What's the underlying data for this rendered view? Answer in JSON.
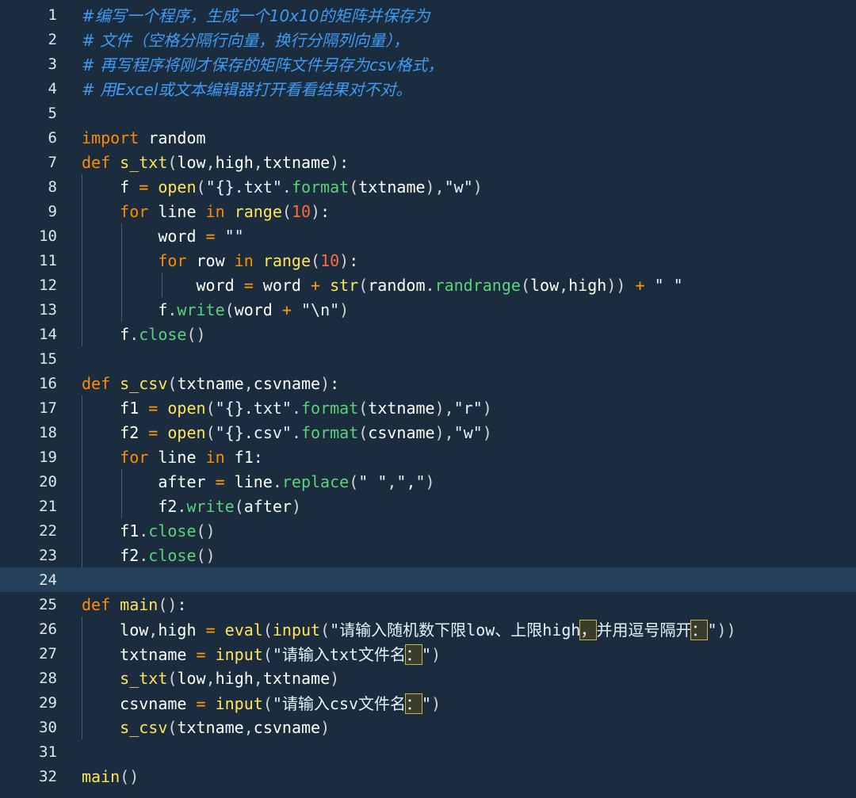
{
  "editor": {
    "current_line": 24,
    "lines": [
      {
        "n": "1",
        "code": "#编写一个程序，生成一个10x10的矩阵并保存为"
      },
      {
        "n": "2",
        "code": "# 文件（空格分隔行向量，换行分隔列向量），"
      },
      {
        "n": "3",
        "code": "# 再写程序将刚才保存的矩阵文件另存为csv格式，"
      },
      {
        "n": "4",
        "code": "# 用Excel或文本编辑器打开看看结果对不对。"
      },
      {
        "n": "5",
        "code": ""
      },
      {
        "n": "6",
        "code": "import random"
      },
      {
        "n": "7",
        "code": "def s_txt(low,high,txtname):"
      },
      {
        "n": "8",
        "code": "    f = open(\"{}.txt\".format(txtname),\"w\")"
      },
      {
        "n": "9",
        "code": "    for line in range(10):"
      },
      {
        "n": "10",
        "code": "        word = \"\""
      },
      {
        "n": "11",
        "code": "        for row in range(10):"
      },
      {
        "n": "12",
        "code": "            word = word + str(random.randrange(low,high)) + \" \""
      },
      {
        "n": "13",
        "code": "        f.write(word + \"\\n\")"
      },
      {
        "n": "14",
        "code": "    f.close()"
      },
      {
        "n": "15",
        "code": ""
      },
      {
        "n": "16",
        "code": "def s_csv(txtname,csvname):"
      },
      {
        "n": "17",
        "code": "    f1 = open(\"{}.txt\".format(txtname),\"r\")"
      },
      {
        "n": "18",
        "code": "    f2 = open(\"{}.csv\".format(csvname),\"w\")"
      },
      {
        "n": "19",
        "code": "    for line in f1:"
      },
      {
        "n": "20",
        "code": "        after = line.replace(\" \",\",\")"
      },
      {
        "n": "21",
        "code": "        f2.write(after)"
      },
      {
        "n": "22",
        "code": "    f1.close()"
      },
      {
        "n": "23",
        "code": "    f2.close()"
      },
      {
        "n": "24",
        "code": ""
      },
      {
        "n": "25",
        "code": "def main():"
      },
      {
        "n": "26",
        "code": "    low,high = eval(input(\"请输入随机数下限low、上限high，并用逗号隔开：\"))"
      },
      {
        "n": "27",
        "code": "    txtname = input(\"请输入txt文件名：\")"
      },
      {
        "n": "28",
        "code": "    s_txt(low,high,txtname)"
      },
      {
        "n": "29",
        "code": "    csvname = input(\"请输入csv文件名：\")"
      },
      {
        "n": "30",
        "code": "    s_csv(txtname,csvname)"
      },
      {
        "n": "31",
        "code": ""
      },
      {
        "n": "32",
        "code": "main()"
      }
    ]
  },
  "colors": {
    "background": "#1b2c3f",
    "current_line": "#24405a",
    "comment": "#3f9bf2",
    "keyword": "#ff8c00",
    "function": "#ffe45c",
    "method": "#5cd17a",
    "number": "#ff6a3d",
    "text": "#ffffff"
  }
}
